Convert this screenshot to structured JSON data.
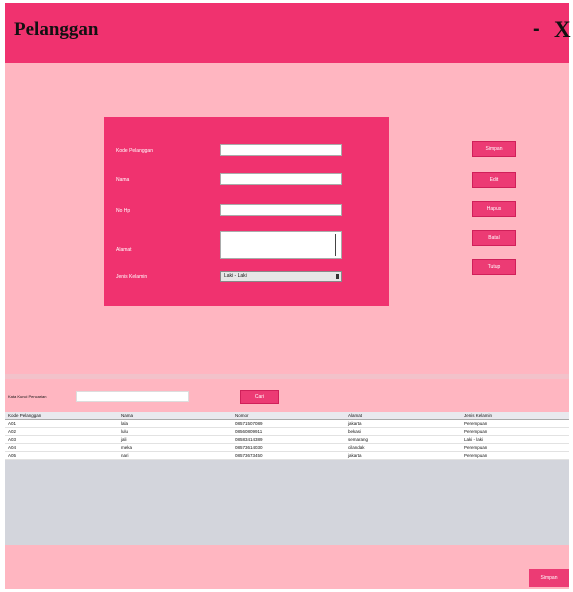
{
  "window": {
    "title": "Pelanggan",
    "minimize_glyph": "-",
    "close_glyph": "X"
  },
  "form": {
    "kode": {
      "label": "Kode Pelanggan",
      "value": ""
    },
    "nama": {
      "label": "Nama",
      "value": ""
    },
    "telp": {
      "label": "No Hp",
      "value": ""
    },
    "alamat": {
      "label": "Alamat",
      "value": ""
    },
    "jenis_kelamin": {
      "label": "Jenis Kelamin",
      "value": "Laki - Laki"
    }
  },
  "actions": {
    "baru": "Simpan",
    "edit": "Edit",
    "hapus": "Hapus",
    "batal": "Batal",
    "tutup": "Tutup"
  },
  "search": {
    "label": "Kata Kunci Pencarian",
    "value": "",
    "button": "Cari"
  },
  "table": {
    "columns": [
      "Kode Pelanggan",
      "Nama",
      "Nomor",
      "Alamat",
      "Jenis Kelamin"
    ],
    "rows": [
      [
        "A01",
        "lala",
        "08571507089",
        "jakarta",
        "Perempuan"
      ],
      [
        "A02",
        "lulu",
        "08560809911",
        "bekasi",
        "Perempuan"
      ],
      [
        "A03",
        "jali",
        "08583414389",
        "semarang",
        "Laki - laki"
      ],
      [
        "A04",
        "meka",
        "08573614030",
        "cilandak",
        "Perempuan"
      ],
      [
        "A05",
        "nari",
        "08573673450",
        "jakarta",
        "Perempuan"
      ]
    ]
  },
  "footer": {
    "save": "Simpan"
  }
}
